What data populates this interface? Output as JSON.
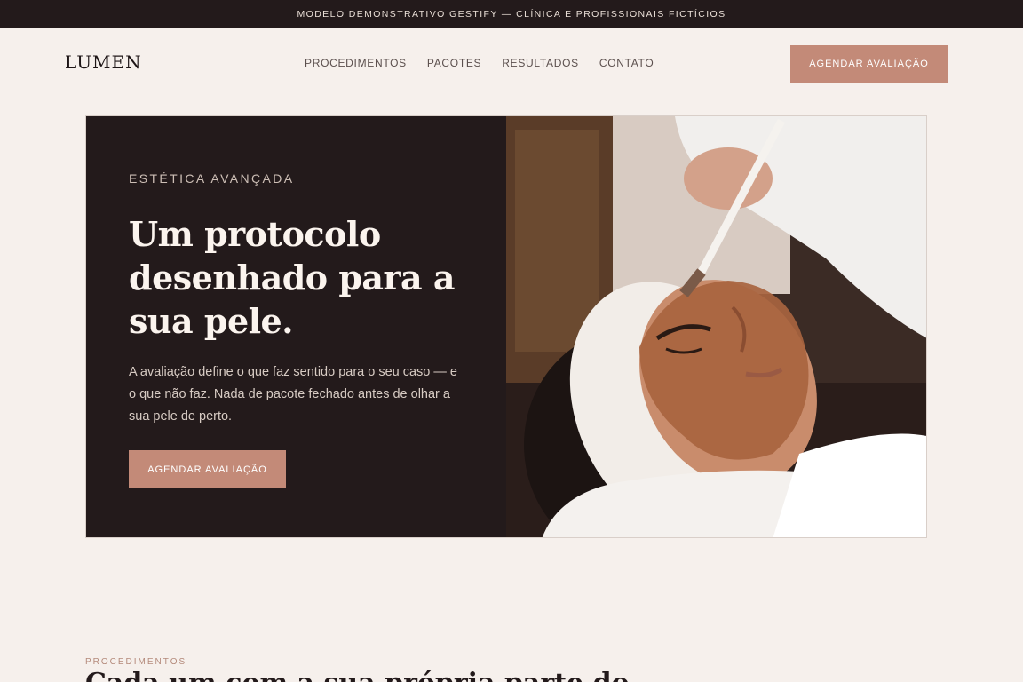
{
  "topbar": {
    "text": "MODELO DEMONSTRATIVO GESTIFY — CLÍNICA E PROFISSIONAIS FICTÍCIOS"
  },
  "brand": {
    "name": "LUMEN"
  },
  "nav": {
    "items": [
      {
        "label": "PROCEDIMENTOS"
      },
      {
        "label": "PACOTES"
      },
      {
        "label": "RESULTADOS"
      },
      {
        "label": "CONTATO"
      }
    ],
    "cta_label": "AGENDAR AVALIAÇÃO"
  },
  "hero": {
    "eyebrow": "ESTÉTICA AVANÇADA",
    "headline": "Um protocolo desenhado para a sua pele.",
    "lede": "A avaliação define o que faz sentido para o seu caso — e o que não faz. Nada de pacote fechado antes de olhar a sua pele de perto.",
    "cta_label": "AGENDAR AVALIAÇÃO"
  },
  "section": {
    "eyebrow": "PROCEDIMENTOS",
    "title": "Cada um com a sua própria parte do"
  },
  "colors": {
    "accent": "#c38a78",
    "dark": "#231a1b",
    "background": "#f6f0ec"
  }
}
